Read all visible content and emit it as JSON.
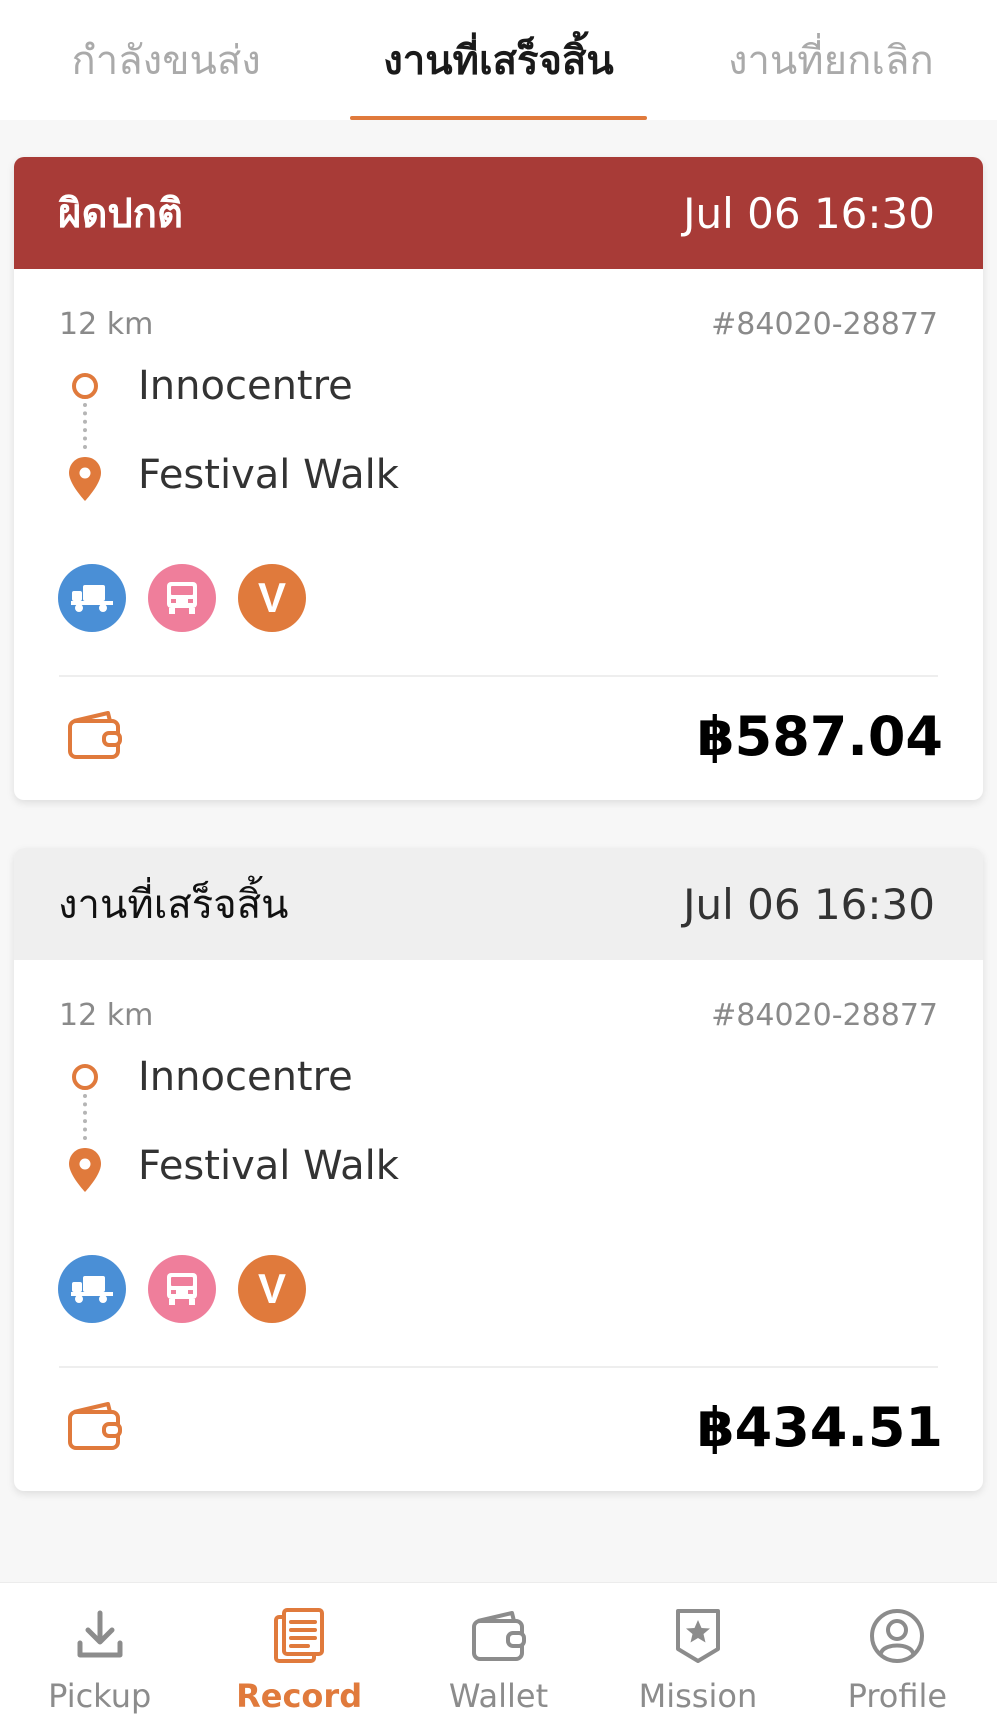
{
  "tabs": [
    {
      "label": "กำลังขนส่ง",
      "active": false
    },
    {
      "label": "งานที่เสร็จสิ้น",
      "active": true
    },
    {
      "label": "งานที่ยกเลิก",
      "active": false
    }
  ],
  "orders": [
    {
      "status": "ผิดปกติ",
      "time": "Jul 06 16:30",
      "distance": "12 km",
      "order_id": "#84020-28877",
      "origin": "Innocentre",
      "destination": "Festival Walk",
      "service_icons": [
        "truck-icon",
        "van-icon",
        "v-badge-icon"
      ],
      "service_v_label": "V",
      "price": "฿587.04"
    },
    {
      "status": "งานที่เสร็จสิ้น",
      "time": "Jul 06 16:30",
      "distance": "12 km",
      "order_id": "#84020-28877",
      "origin": "Innocentre",
      "destination": "Festival Walk",
      "service_icons": [
        "truck-icon",
        "van-icon",
        "v-badge-icon"
      ],
      "service_v_label": "V",
      "price": "฿434.51"
    }
  ],
  "bottom_nav": [
    {
      "label": "Pickup",
      "icon": "download-icon",
      "active": false
    },
    {
      "label": "Record",
      "icon": "document-icon",
      "active": true
    },
    {
      "label": "Wallet",
      "icon": "wallet-icon",
      "active": false
    },
    {
      "label": "Mission",
      "icon": "star-badge-icon",
      "active": false
    },
    {
      "label": "Profile",
      "icon": "profile-icon",
      "active": false
    }
  ],
  "colors": {
    "accent": "#e07a3c",
    "abnormal_header": "#a83b37",
    "completed_header": "#efefef",
    "truck_icon_bg": "#4a8fd6",
    "van_icon_bg": "#ef7e9b"
  }
}
